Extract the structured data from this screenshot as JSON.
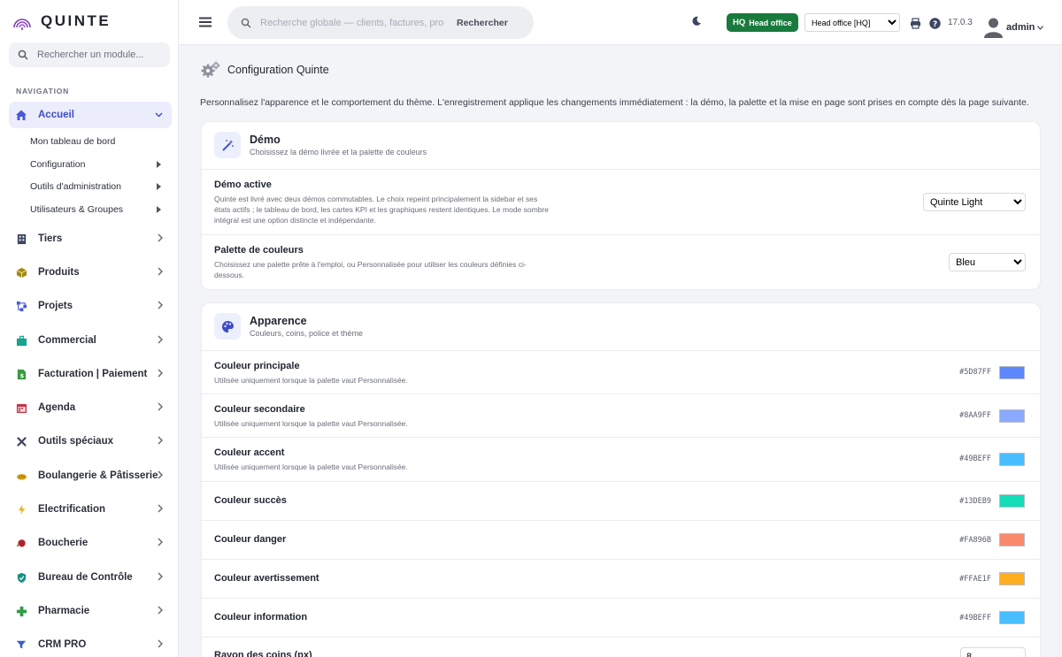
{
  "app": {
    "brand": "QUINTE",
    "version": "17.0.3",
    "user": "admin"
  },
  "sidebar": {
    "search_placeholder": "Rechercher un module...",
    "nav_title": "NAVIGATION",
    "items": [
      {
        "label": "Accueil",
        "icon": "home-icon",
        "color": "#4a57d6"
      },
      {
        "label": "Tiers",
        "icon": "building-icon",
        "color": "#3f4663"
      },
      {
        "label": "Produits",
        "icon": "box-icon",
        "color": "#a48a12"
      },
      {
        "label": "Projets",
        "icon": "sitemap-icon",
        "color": "#4a57d6"
      },
      {
        "label": "Commercial",
        "icon": "suitcase-icon",
        "color": "#19a290"
      },
      {
        "label": "Facturation | Paiement",
        "icon": "invoice-icon",
        "color": "#3a9b3f"
      },
      {
        "label": "Agenda",
        "icon": "calendar-icon",
        "color": "#c0394b"
      },
      {
        "label": "Outils spéciaux",
        "icon": "tools-icon",
        "color": "#3f4663"
      },
      {
        "label": "Boulangerie & Pâtisserie",
        "icon": "bread-icon",
        "color": "#d6a21b"
      },
      {
        "label": "Electrification",
        "icon": "bolt-icon",
        "color": "#e8b315"
      },
      {
        "label": "Boucherie",
        "icon": "meat-icon",
        "color": "#b0242d"
      },
      {
        "label": "Bureau de Contrôle",
        "icon": "shield-icon",
        "color": "#1a8f86"
      },
      {
        "label": "Pharmacie",
        "icon": "cross-icon",
        "color": "#2e9d45"
      },
      {
        "label": "CRM PRO",
        "icon": "funnel-icon",
        "color": "#3a5fc8"
      }
    ],
    "subitems": [
      {
        "label": "Mon tableau de bord"
      },
      {
        "label": "Configuration"
      },
      {
        "label": "Outils d'administration"
      },
      {
        "label": "Utilisateurs & Groupes"
      }
    ]
  },
  "topbar": {
    "search_placeholder": "Recherche globale — clients, factures, prod",
    "search_button": "Rechercher",
    "hq_code": "HQ",
    "hq_label": "Head office",
    "entity_selected": "Head office [HQ]"
  },
  "page": {
    "title": "Configuration Quinte",
    "intro": "Personnalisez l'apparence et le comportement du thème. L'enregistrement applique les changements immédiatement : la démo, la palette et la mise en page sont prises en compte dès la page suivante."
  },
  "demo_card": {
    "title": "Démo",
    "subtitle": "Choisissez la démo livrée et la palette de couleurs",
    "demo_label": "Démo active",
    "demo_desc": "Quinte est livré avec deux démos commutables. Le choix repeint principalement la sidebar et ses états actifs ; le tableau de bord, les cartes KPI et les graphiques restent identiques. Le mode sombre intégral est une option distincte et indépendante.",
    "demo_value": "Quinte Light",
    "palette_label": "Palette de couleurs",
    "palette_desc": "Choisissez une palette prête à l'emploi, ou Personnalisée pour utiliser les couleurs définies ci-dessous.",
    "palette_value": "Bleu"
  },
  "appearance_card": {
    "title": "Apparence",
    "subtitle": "Couleurs, coins, police et thème",
    "colors": [
      {
        "label": "Couleur principale",
        "desc": "Utilisée uniquement lorsque la palette vaut Personnalisée.",
        "hex": "#5D87FF",
        "color": "#5D87FF"
      },
      {
        "label": "Couleur secondaire",
        "desc": "Utilisée uniquement lorsque la palette vaut Personnalisée.",
        "hex": "#8AA9FF",
        "color": "#8AA9FF"
      },
      {
        "label": "Couleur accent",
        "desc": "Utilisée uniquement lorsque la palette vaut Personnalisée.",
        "hex": "#49BEFF",
        "color": "#49BEFF"
      },
      {
        "label": "Couleur succès",
        "desc": "",
        "hex": "#13DEB9",
        "color": "#13DEB9"
      },
      {
        "label": "Couleur danger",
        "desc": "",
        "hex": "#FA896B",
        "color": "#FA896B"
      },
      {
        "label": "Couleur avertissement",
        "desc": "",
        "hex": "#FFAE1F",
        "color": "#FFAE1F"
      },
      {
        "label": "Couleur information",
        "desc": "",
        "hex": "#49BEFF",
        "color": "#49BEFF"
      }
    ],
    "radius_label": "Rayon des coins (px)",
    "radius_value": "8"
  }
}
